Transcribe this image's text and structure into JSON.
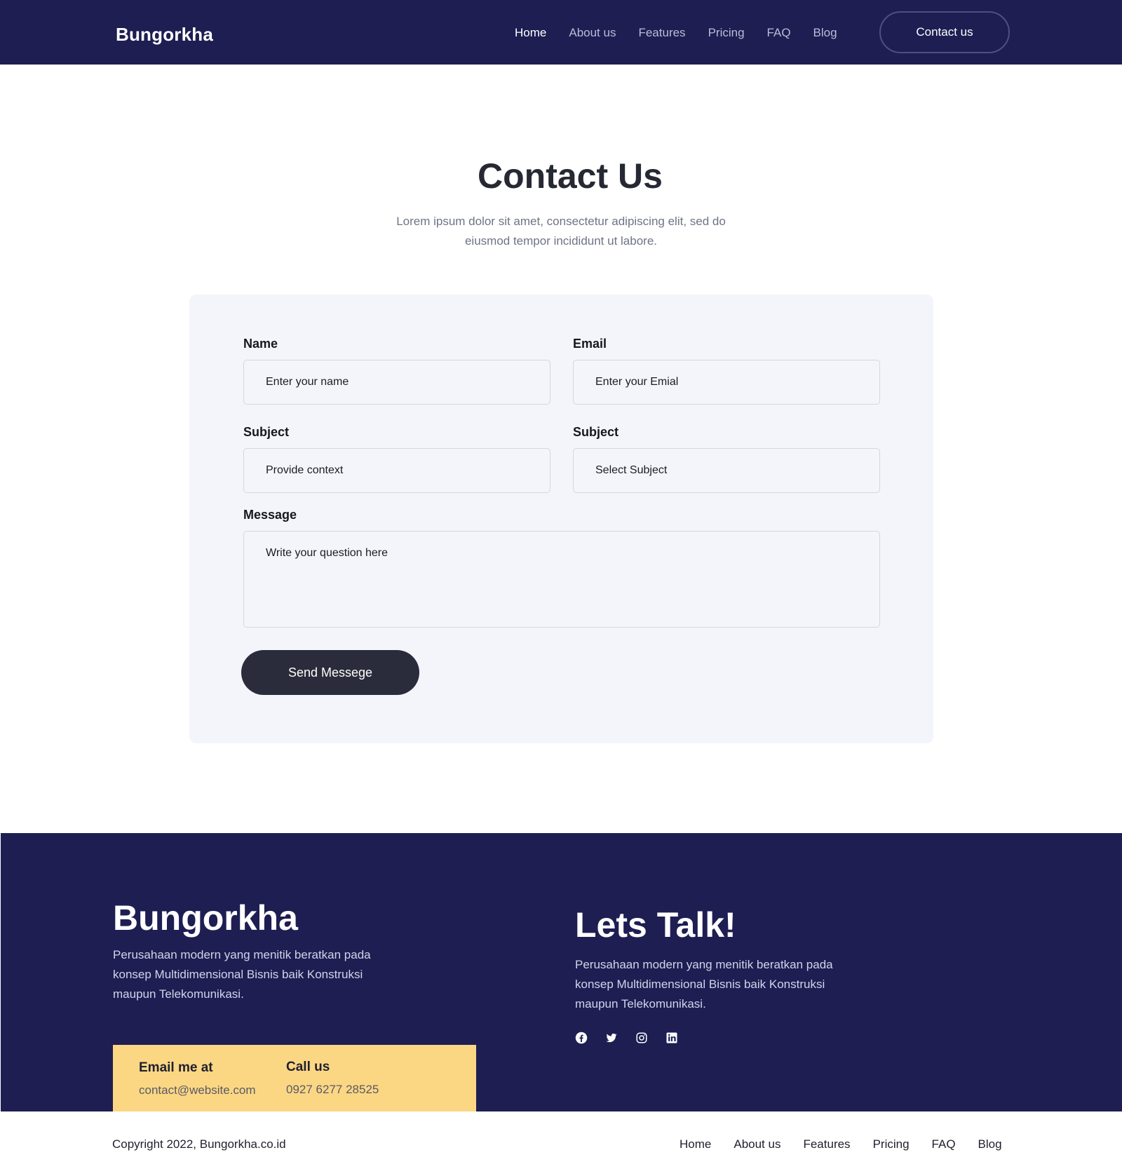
{
  "header": {
    "logo": "Bungorkha",
    "nav": [
      "Home",
      "About us",
      "Features",
      "Pricing",
      "FAQ",
      "Blog"
    ],
    "cta": "Contact us"
  },
  "hero": {
    "title": "Contact Us",
    "subtitle": "Lorem ipsum dolor sit amet, consectetur adipiscing elit, sed do eiusmod tempor incididunt ut labore."
  },
  "form": {
    "name_label": "Name",
    "name_placeholder": "Enter your name",
    "email_label": "Email",
    "email_placeholder": "Enter your Emial",
    "subject_label": "Subject",
    "subject_placeholder": "Provide context",
    "subject_select_label": "Subject",
    "subject_select_value": "Select Subject",
    "message_label": "Message",
    "message_placeholder": "Write your  question here",
    "send_label": "Send Messege"
  },
  "footer": {
    "brand": "Bungorkha",
    "brand_desc": "Perusahaan modern yang menitik beratkan pada konsep Multidimensional Bisnis baik Konstruksi maupun Telekomunikasi.",
    "talk_title": "Lets Talk!",
    "talk_desc": "Perusahaan modern yang menitik beratkan pada konsep Multidimensional Bisnis baik Konstruksi maupun Telekomunikasi.",
    "socials": [
      "facebook-icon",
      "twitter-icon",
      "instagram-icon",
      "linkedin-icon"
    ],
    "email_label": "Email me at",
    "email_value": "contact@website.com",
    "call_label": "Call us",
    "call_value": "0927 6277 28525"
  },
  "bottom": {
    "copyright": "Copyright 2022, Bungorkha.co.id",
    "nav": [
      "Home",
      "About us",
      "Features",
      "Pricing",
      "FAQ",
      "Blog"
    ]
  },
  "colors": {
    "navy": "#1e1e53",
    "card_bg": "#f4f5fa",
    "button_dark": "#2b2c3b",
    "accent_yellow": "#fbd784"
  }
}
